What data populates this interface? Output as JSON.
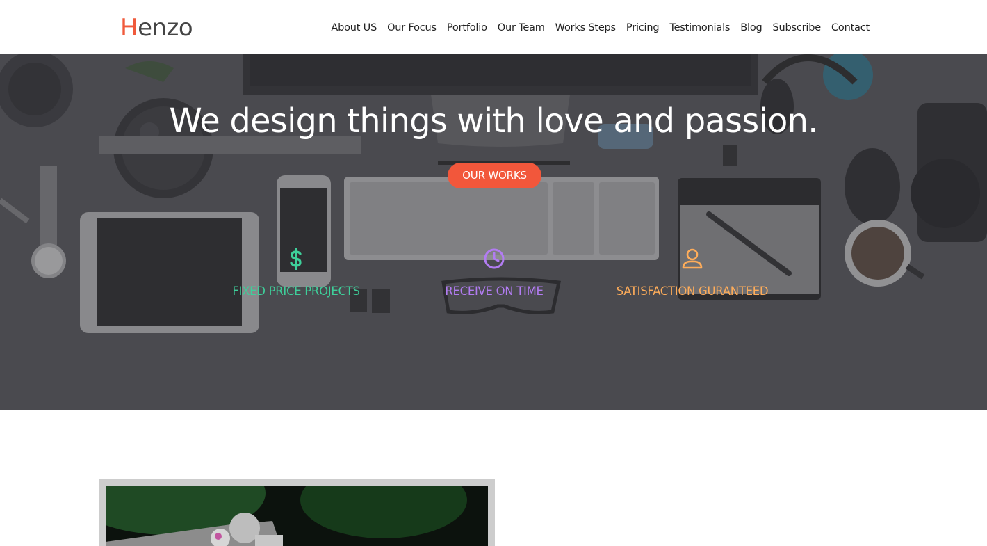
{
  "brand": {
    "first_letter": "H",
    "rest": "enzo",
    "accent": "#f05a3c"
  },
  "nav": {
    "items": [
      {
        "label": "About US"
      },
      {
        "label": "Our Focus"
      },
      {
        "label": "Portfolio"
      },
      {
        "label": "Our Team"
      },
      {
        "label": "Works Steps"
      },
      {
        "label": "Pricing"
      },
      {
        "label": "Testimonials"
      },
      {
        "label": "Blog"
      },
      {
        "label": "Subscribe"
      },
      {
        "label": "Contact"
      }
    ]
  },
  "hero": {
    "title": "We design things with love and passion.",
    "cta_label": "OUR WORKS",
    "cta_color": "#f2573b",
    "features": [
      {
        "icon": "dollar-icon",
        "label": "FIXED PRICE PROJECTS",
        "color": "#3ecf9a"
      },
      {
        "icon": "clock-icon",
        "label": "RECEIVE ON TIME",
        "color": "#b27cf2"
      },
      {
        "icon": "user-icon",
        "label": "SATISFACTION GURANTEED",
        "color": "#ffad5a"
      }
    ]
  }
}
